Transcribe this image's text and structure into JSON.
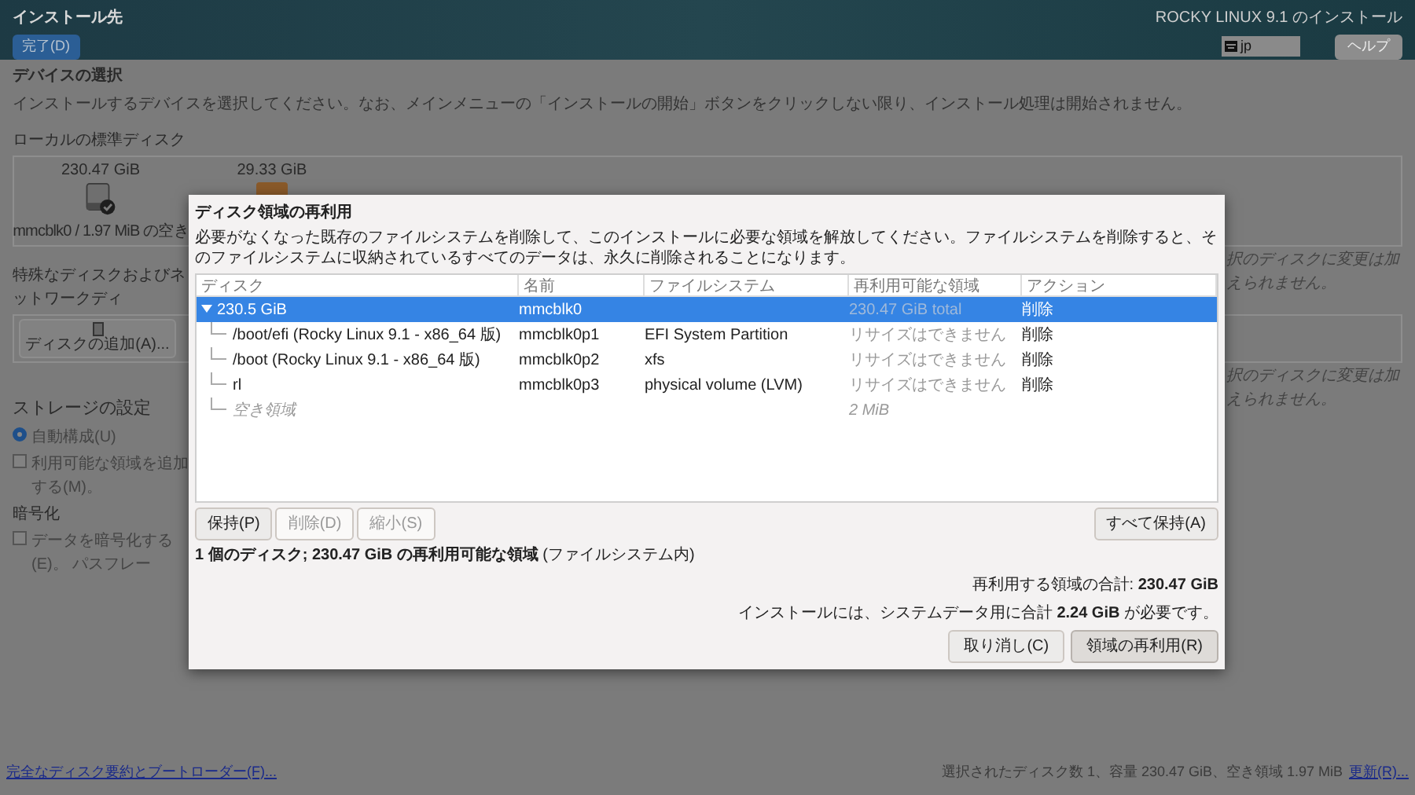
{
  "header": {
    "title": "インストール先",
    "done_button": "完了(D)",
    "product": "ROCKY LINUX 9.1 のインストール",
    "keyboard": "jp",
    "help_button": "ヘルプ"
  },
  "page": {
    "heading": "デバイスの選択",
    "description": "インストールするデバイスを選択してください。なお、メインメニューの「インストールの開始」ボタンをクリックしない限り、インストール処理は開始されません。",
    "local_disks_label": "ローカルの標準ディスク",
    "disks": [
      {
        "kind": "hdd",
        "size": "230.47 GiB",
        "label": "mmcblk0 / 1.97 MiB の空き",
        "selected": true
      },
      {
        "kind": "usb",
        "size": "29.33 GiB",
        "selected": false
      }
    ],
    "local_note": "択のディスクに変更は加えられません。",
    "special_label": "特殊なディスクおよびネットワークディ",
    "add_disk_button": "ディスクの追加(A)...",
    "special_note": "択のディスクに変更は加えられません。",
    "storage_heading": "ストレージの設定",
    "options": [
      {
        "kind": "radio",
        "label": "自動構成(U)",
        "selected": true
      },
      {
        "kind": "checkbox",
        "label": "利用可能な領域を追加する(M)。",
        "checked": false
      }
    ],
    "encryption_heading": "暗号化",
    "encrypt_option": {
      "label": "データを暗号化する(E)。 パスフレー",
      "checked": false
    }
  },
  "dialog": {
    "title": "ディスク領域の再利用",
    "description": "必要がなくなった既存のファイルシステムを削除して、このインストールに必要な領域を解放してください。ファイルシステムを削除すると、そのファイルシステムに収納されているすべてのデータは、永久に削除されることになります。",
    "columns": [
      "ディスク",
      "名前",
      "ファイルシステム",
      "再利用可能な領域",
      "アクション"
    ],
    "rows": [
      {
        "disk": "230.5 GiB",
        "name": "mmcblk0",
        "reclaimable": "230.47 GiB total",
        "action": "削除",
        "expanded": true,
        "selected": true,
        "children": [
          {
            "kind": "partition",
            "disk": "/boot/efi (Rocky Linux 9.1 - x86_64 版)",
            "name": "mmcblk0p1",
            "filesystem": "EFI System Partition",
            "reclaimable": "リサイズはできません",
            "action": "削除",
            "selected": false
          },
          {
            "kind": "partition",
            "disk": "/boot (Rocky Linux 9.1 - x86_64 版)",
            "name": "mmcblk0p2",
            "filesystem": "xfs",
            "reclaimable": "リサイズはできません",
            "action": "削除",
            "selected": false
          },
          {
            "kind": "partition",
            "disk": "rl",
            "name": "mmcblk0p3",
            "filesystem": "physical volume (LVM)",
            "reclaimable": "リサイズはできません",
            "action": "削除",
            "selected": false
          },
          {
            "kind": "free",
            "disk": "空き領域",
            "reclaimable": "2 MiB",
            "selected": false
          }
        ]
      }
    ],
    "row_buttons": [
      {
        "label": "保持(P)",
        "disabled": false
      },
      {
        "label": "削除(D)",
        "disabled": true
      },
      {
        "label": "縮小(S)",
        "disabled": true
      }
    ],
    "keep_all_button": "すべて保持(A)",
    "summary": "**1 個のディスク; 230.47 GiB の再利用可能な領域** (ファイルシステム内)",
    "total": "再利用する領域の合計: **230.47 GiB**",
    "required": "インストールには、システムデータ用に合計 **2.24 GiB** が必要です。",
    "cancel_button": "取り消し(C)",
    "reclaim_button": "領域の再利用(R)"
  },
  "footer": {
    "link": "完全なディスク要約とブートローダー(F)...",
    "summary": "選択されたディスク数 1、容量 230.47 GiB、空き領域 1.97 MiB",
    "refresh_link": "更新(R)..."
  }
}
